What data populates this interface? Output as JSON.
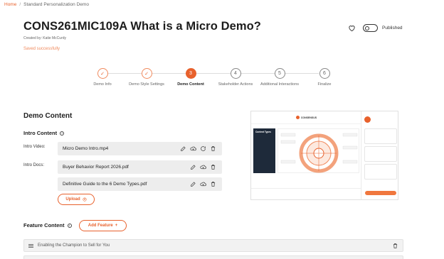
{
  "breadcrumb": {
    "home": "Home",
    "separator": "/",
    "current": "Standard Personalization Demo"
  },
  "header": {
    "title": "CONS261MIC109A What is a Micro Demo?",
    "created_by": "Created by: Katie McCurdy",
    "saved_status": "Saved successfully",
    "publish_label": "Published",
    "published": true
  },
  "stepper": {
    "steps": [
      {
        "number": "✓",
        "label": "Demo Info",
        "state": "done"
      },
      {
        "number": "✓",
        "label": "Demo Style Settings",
        "state": "done"
      },
      {
        "number": "3",
        "label": "Demo Content",
        "state": "active"
      },
      {
        "number": "4",
        "label": "Stakeholder Actions",
        "state": "todo"
      },
      {
        "number": "5",
        "label": "Additional Interactions",
        "state": "todo"
      },
      {
        "number": "6",
        "label": "Finalize",
        "state": "todo"
      }
    ]
  },
  "content": {
    "section_title": "Demo Content",
    "intro_title": "Intro Content",
    "intro_video_label": "Intro Video:",
    "intro_video_file": "Micro Demo Intro.mp4",
    "intro_docs_label": "Intro Docs:",
    "intro_docs": [
      "Buyer Behavior Report 2026.pdf",
      "Definitive Guide to the 6 Demo Types.pdf"
    ],
    "upload_label": "Upload",
    "feature_title": "Feature Content",
    "add_feature_label": "Add Feature",
    "features": [
      "Enabling the Champion to Sell for You"
    ]
  },
  "preview": {
    "brand": "CONSENSUS",
    "side_panel_title": "Content Types"
  },
  "colors": {
    "accent": "#e8612c",
    "accent_light": "#f08a5d"
  }
}
